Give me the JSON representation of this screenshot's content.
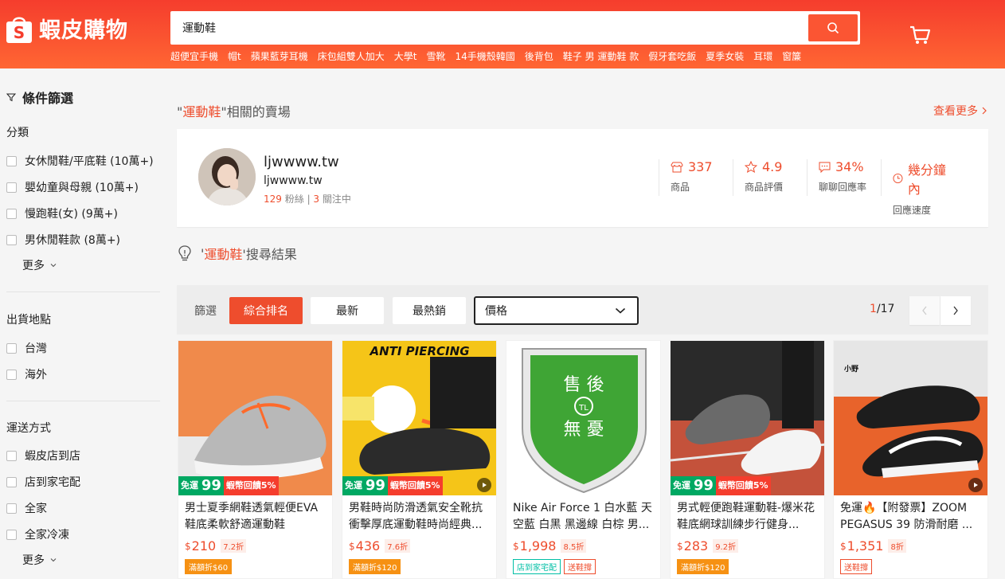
{
  "header": {
    "logo_text": "蝦皮購物",
    "search_value": "運動鞋",
    "hints": [
      "超便宜手機",
      "帽t",
      "蘋果藍芽耳機",
      "床包組雙人加大",
      "大學t",
      "雪靴",
      "14手機殼韓國",
      "後背包",
      "鞋子 男 運動鞋 款",
      "假牙套吃飯",
      "夏季女裝",
      "耳環",
      "窗簾"
    ]
  },
  "sidebar": {
    "filter_title": "條件篩選",
    "category": {
      "title": "分類",
      "items": [
        "女休閒鞋/平底鞋 (10萬+)",
        "嬰幼童與母親 (10萬+)",
        "慢跑鞋(女) (9萬+)",
        "男休閒鞋款 (8萬+)"
      ],
      "more": "更多"
    },
    "location": {
      "title": "出貨地點",
      "items": [
        "台灣",
        "海外"
      ]
    },
    "shipping": {
      "title": "運送方式",
      "items": [
        "蝦皮店到店",
        "店到家宅配",
        "全家",
        "全家冷凍"
      ],
      "more": "更多"
    }
  },
  "shop_section": {
    "prefix": "\"",
    "keyword": "運動鞋",
    "suffix": "\"相關的賣場",
    "see_more": "查看更多",
    "shop": {
      "name": "ljwwww.tw",
      "username": "ljwwww.tw",
      "followers": "129",
      "followers_label": "粉絲",
      "sep": " | ",
      "following": "3",
      "following_label": "關注中",
      "stats": [
        {
          "value": "337",
          "label": "商品",
          "icon": "shop-icon"
        },
        {
          "value": "4.9",
          "label": "商品評價",
          "icon": "star-icon"
        },
        {
          "value": "34%",
          "label": "聊聊回應率",
          "icon": "chat-icon"
        },
        {
          "value": "幾分鐘內",
          "label": "回應速度",
          "icon": "clock-icon"
        }
      ]
    }
  },
  "results": {
    "prefix": "'",
    "keyword": "運動鞋",
    "suffix": "'搜尋結果"
  },
  "sortbar": {
    "label": "篩選",
    "buttons": [
      "綜合排名",
      "最新",
      "最熱銷"
    ],
    "price": "價格",
    "page_current": "1",
    "page_total": "/17"
  },
  "products": [
    {
      "title": "男士夏季網鞋透氣輕便EVA鞋底柔軟舒適運動鞋",
      "currency": "$",
      "price": "210",
      "discount": "7.2折",
      "promo_a": "免運",
      "promo_num": "99",
      "promo_b": "蝦幣回饋5%",
      "tag": "滿額折$60",
      "tag_style": "orange"
    },
    {
      "title": "男鞋時尚防滑透氣安全靴抗衝擊厚底運動鞋時尚經典...",
      "currency": "$",
      "price": "436",
      "discount": "7.6折",
      "promo_a": "免運",
      "promo_num": "99",
      "promo_b": "蝦幣回饋5%",
      "tag": "滿額折$120",
      "tag_style": "orange",
      "image_text": "ANTI PIERCING"
    },
    {
      "title": "Nike Air Force 1 白水藍 天空藍 白黑 黑邊線 白棕 男...",
      "currency": "$",
      "price": "1,998",
      "discount": "8.5折",
      "tag": "店到家宅配",
      "tag_style": "green",
      "tag2": "送鞋撐",
      "image_text_1": "售 後",
      "image_text_2": "TL",
      "image_text_3": "無 憂"
    },
    {
      "title": "男式輕便跑鞋運動鞋-爆米花鞋底網球訓練步行健身...",
      "currency": "$",
      "price": "283",
      "discount": "9.2折",
      "promo_a": "免運",
      "promo_num": "99",
      "promo_b": "蝦幣回饋5%",
      "tag": "滿額折$120",
      "tag_style": "orange"
    },
    {
      "title": "免運🔥【附發票】ZOOM PEGASUS 39 防滑耐磨 ...",
      "currency": "$",
      "price": "1,351",
      "discount": "8折",
      "tag": "送鞋撐",
      "tag_style": "red",
      "image_text": "小野"
    }
  ]
}
